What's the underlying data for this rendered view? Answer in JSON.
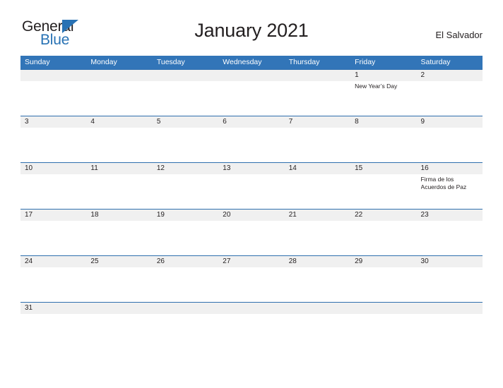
{
  "brand": {
    "word_one": "General",
    "word_two": "Blue",
    "triangle_icon": "triangle-right-icon",
    "accent_color": "#2872b4"
  },
  "header": {
    "title": "January 2021",
    "region": "El Salvador"
  },
  "calendar": {
    "header_bg": "#3275b8",
    "row_divider": "#2f6fae",
    "date_strip_bg": "#f0f0f0",
    "weekdays": [
      "Sunday",
      "Monday",
      "Tuesday",
      "Wednesday",
      "Thursday",
      "Friday",
      "Saturday"
    ],
    "weeks": [
      {
        "short": false,
        "cells": [
          {
            "day": "",
            "events": []
          },
          {
            "day": "",
            "events": []
          },
          {
            "day": "",
            "events": []
          },
          {
            "day": "",
            "events": []
          },
          {
            "day": "",
            "events": []
          },
          {
            "day": "1",
            "events": [
              "New Year’s Day"
            ]
          },
          {
            "day": "2",
            "events": []
          }
        ]
      },
      {
        "short": false,
        "cells": [
          {
            "day": "3",
            "events": []
          },
          {
            "day": "4",
            "events": []
          },
          {
            "day": "5",
            "events": []
          },
          {
            "day": "6",
            "events": []
          },
          {
            "day": "7",
            "events": []
          },
          {
            "day": "8",
            "events": []
          },
          {
            "day": "9",
            "events": []
          }
        ]
      },
      {
        "short": false,
        "cells": [
          {
            "day": "10",
            "events": []
          },
          {
            "day": "11",
            "events": []
          },
          {
            "day": "12",
            "events": []
          },
          {
            "day": "13",
            "events": []
          },
          {
            "day": "14",
            "events": []
          },
          {
            "day": "15",
            "events": []
          },
          {
            "day": "16",
            "events": [
              "Firma de los",
              "Acuerdos de Paz"
            ]
          }
        ]
      },
      {
        "short": false,
        "cells": [
          {
            "day": "17",
            "events": []
          },
          {
            "day": "18",
            "events": []
          },
          {
            "day": "19",
            "events": []
          },
          {
            "day": "20",
            "events": []
          },
          {
            "day": "21",
            "events": []
          },
          {
            "day": "22",
            "events": []
          },
          {
            "day": "23",
            "events": []
          }
        ]
      },
      {
        "short": false,
        "cells": [
          {
            "day": "24",
            "events": []
          },
          {
            "day": "25",
            "events": []
          },
          {
            "day": "26",
            "events": []
          },
          {
            "day": "27",
            "events": []
          },
          {
            "day": "28",
            "events": []
          },
          {
            "day": "29",
            "events": []
          },
          {
            "day": "30",
            "events": []
          }
        ]
      },
      {
        "short": true,
        "cells": [
          {
            "day": "31",
            "events": []
          },
          {
            "day": "",
            "events": []
          },
          {
            "day": "",
            "events": []
          },
          {
            "day": "",
            "events": []
          },
          {
            "day": "",
            "events": []
          },
          {
            "day": "",
            "events": []
          },
          {
            "day": "",
            "events": []
          }
        ]
      }
    ]
  }
}
